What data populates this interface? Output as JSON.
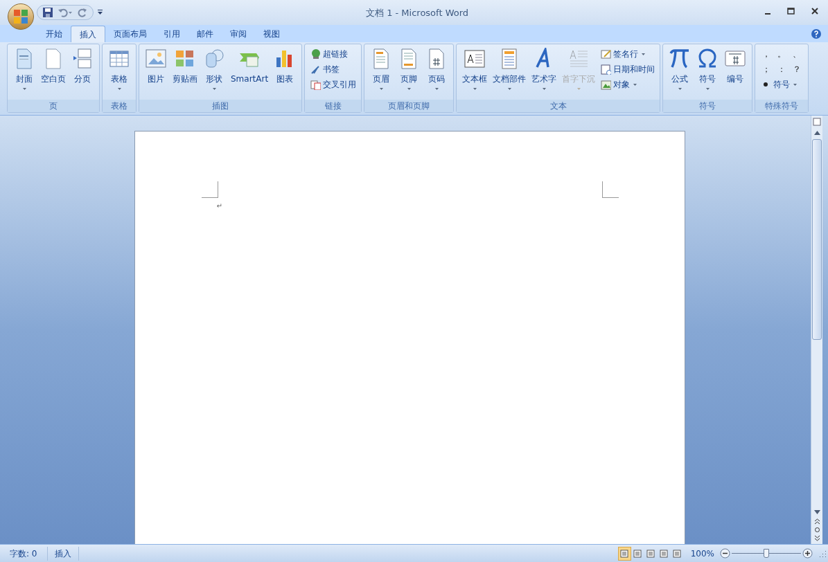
{
  "window": {
    "title": "文档 1 - Microsoft Word"
  },
  "tabs": [
    {
      "label": "开始",
      "selected": false
    },
    {
      "label": "插入",
      "selected": true
    },
    {
      "label": "页面布局",
      "selected": false
    },
    {
      "label": "引用",
      "selected": false
    },
    {
      "label": "邮件",
      "selected": false
    },
    {
      "label": "审阅",
      "selected": false
    },
    {
      "label": "视图",
      "selected": false
    }
  ],
  "ribbon_groups": [
    {
      "label": "页",
      "buttons": [
        {
          "kind": "large",
          "label": "封面",
          "dropdown": true,
          "disabled": false
        },
        {
          "kind": "large",
          "label": "空白页",
          "dropdown": false,
          "disabled": false
        },
        {
          "kind": "large",
          "label": "分页",
          "dropdown": false,
          "disabled": false
        }
      ]
    },
    {
      "label": "表格",
      "buttons": [
        {
          "kind": "large",
          "label": "表格",
          "dropdown": true,
          "disabled": false
        }
      ]
    },
    {
      "label": "插图",
      "buttons": [
        {
          "kind": "large",
          "label": "图片",
          "dropdown": false,
          "disabled": false
        },
        {
          "kind": "large",
          "label": "剪贴画",
          "dropdown": false,
          "disabled": false
        },
        {
          "kind": "large",
          "label": "形状",
          "dropdown": true,
          "disabled": false
        },
        {
          "kind": "large",
          "label": "SmartArt",
          "dropdown": false,
          "disabled": false
        },
        {
          "kind": "large",
          "label": "图表",
          "dropdown": false,
          "disabled": false
        }
      ]
    },
    {
      "label": "链接",
      "buttons": [
        {
          "kind": "small",
          "label": "超链接",
          "dropdown": false,
          "disabled": false
        },
        {
          "kind": "small",
          "label": "书签",
          "dropdown": false,
          "disabled": false
        },
        {
          "kind": "small",
          "label": "交叉引用",
          "dropdown": false,
          "disabled": false
        }
      ]
    },
    {
      "label": "页眉和页脚",
      "buttons": [
        {
          "kind": "large",
          "label": "页眉",
          "dropdown": true,
          "disabled": false
        },
        {
          "kind": "large",
          "label": "页脚",
          "dropdown": true,
          "disabled": false
        },
        {
          "kind": "large",
          "label": "页码",
          "dropdown": true,
          "disabled": false
        }
      ]
    },
    {
      "label": "文本",
      "buttons": [
        {
          "kind": "large",
          "label": "文本框",
          "dropdown": true,
          "disabled": false
        },
        {
          "kind": "large",
          "label": "文档部件",
          "dropdown": true,
          "disabled": false
        },
        {
          "kind": "large",
          "label": "艺术字",
          "dropdown": true,
          "disabled": false
        },
        {
          "kind": "large",
          "label": "首字下沉",
          "dropdown": true,
          "disabled": true
        },
        {
          "kind": "small",
          "label": "签名行",
          "dropdown": true,
          "disabled": false
        },
        {
          "kind": "small",
          "label": "日期和时间",
          "dropdown": false,
          "disabled": false
        },
        {
          "kind": "small",
          "label": "对象",
          "dropdown": true,
          "disabled": false
        }
      ]
    },
    {
      "label": "符号",
      "buttons": [
        {
          "kind": "large",
          "label": "公式",
          "dropdown": true,
          "disabled": false
        },
        {
          "kind": "large",
          "label": "符号",
          "dropdown": true,
          "disabled": false
        },
        {
          "kind": "large",
          "label": "编号",
          "dropdown": false,
          "disabled": false
        }
      ]
    },
    {
      "label": "特殊符号",
      "buttons": [
        {
          "kind": "symbols",
          "symbols": [
            "，",
            "。",
            "、",
            "；",
            "：",
            "？"
          ]
        },
        {
          "kind": "small",
          "label": "符号",
          "dropdown": true,
          "disabled": false
        }
      ]
    }
  ],
  "document": {
    "paragraph_mark": "↵"
  },
  "status_bar": {
    "word_count": "字数: 0",
    "mode": "插入",
    "views": [
      {
        "selected": true
      },
      {
        "selected": false
      },
      {
        "selected": false
      },
      {
        "selected": false
      },
      {
        "selected": false
      }
    ],
    "zoom": "100%",
    "zoom_level": {
      "level": 0.5
    }
  }
}
